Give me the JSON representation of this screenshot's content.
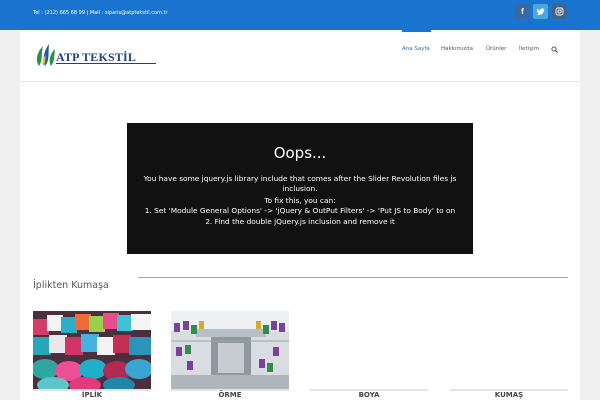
{
  "topbar": {
    "contact": "Tel : (212) 665 68 99  |  Mail : siparis@atptekstil.com.tr",
    "social": [
      "facebook-icon",
      "twitter-icon",
      "instagram-icon"
    ],
    "color": "#1874cf"
  },
  "header": {
    "logo_text": "ATP TEKSTİL",
    "nav": [
      "Ana Sayfa",
      "Hakkımızda",
      "Ürünler",
      "İletişim"
    ],
    "active_nav": "Ana Sayfa",
    "search": "search-icon"
  },
  "slider_error": {
    "title": "Oops...",
    "lines": [
      "You have some jquery.js library include that comes after the Slider Revolution files js",
      "inclusion.",
      "To fix this, you can:",
      "1. Set 'Module General Options' -> 'jQuery & OutPut Filters' -> 'Put JS to Body' to on",
      "2. Find the double jQuery.js inclusion and remove it"
    ]
  },
  "section": {
    "title": "İplikten Kumaşa"
  },
  "cards": [
    {
      "label": "İPLİK"
    },
    {
      "label": "ÖRME"
    },
    {
      "label": "BOYA"
    },
    {
      "label": "KUMAŞ"
    }
  ]
}
